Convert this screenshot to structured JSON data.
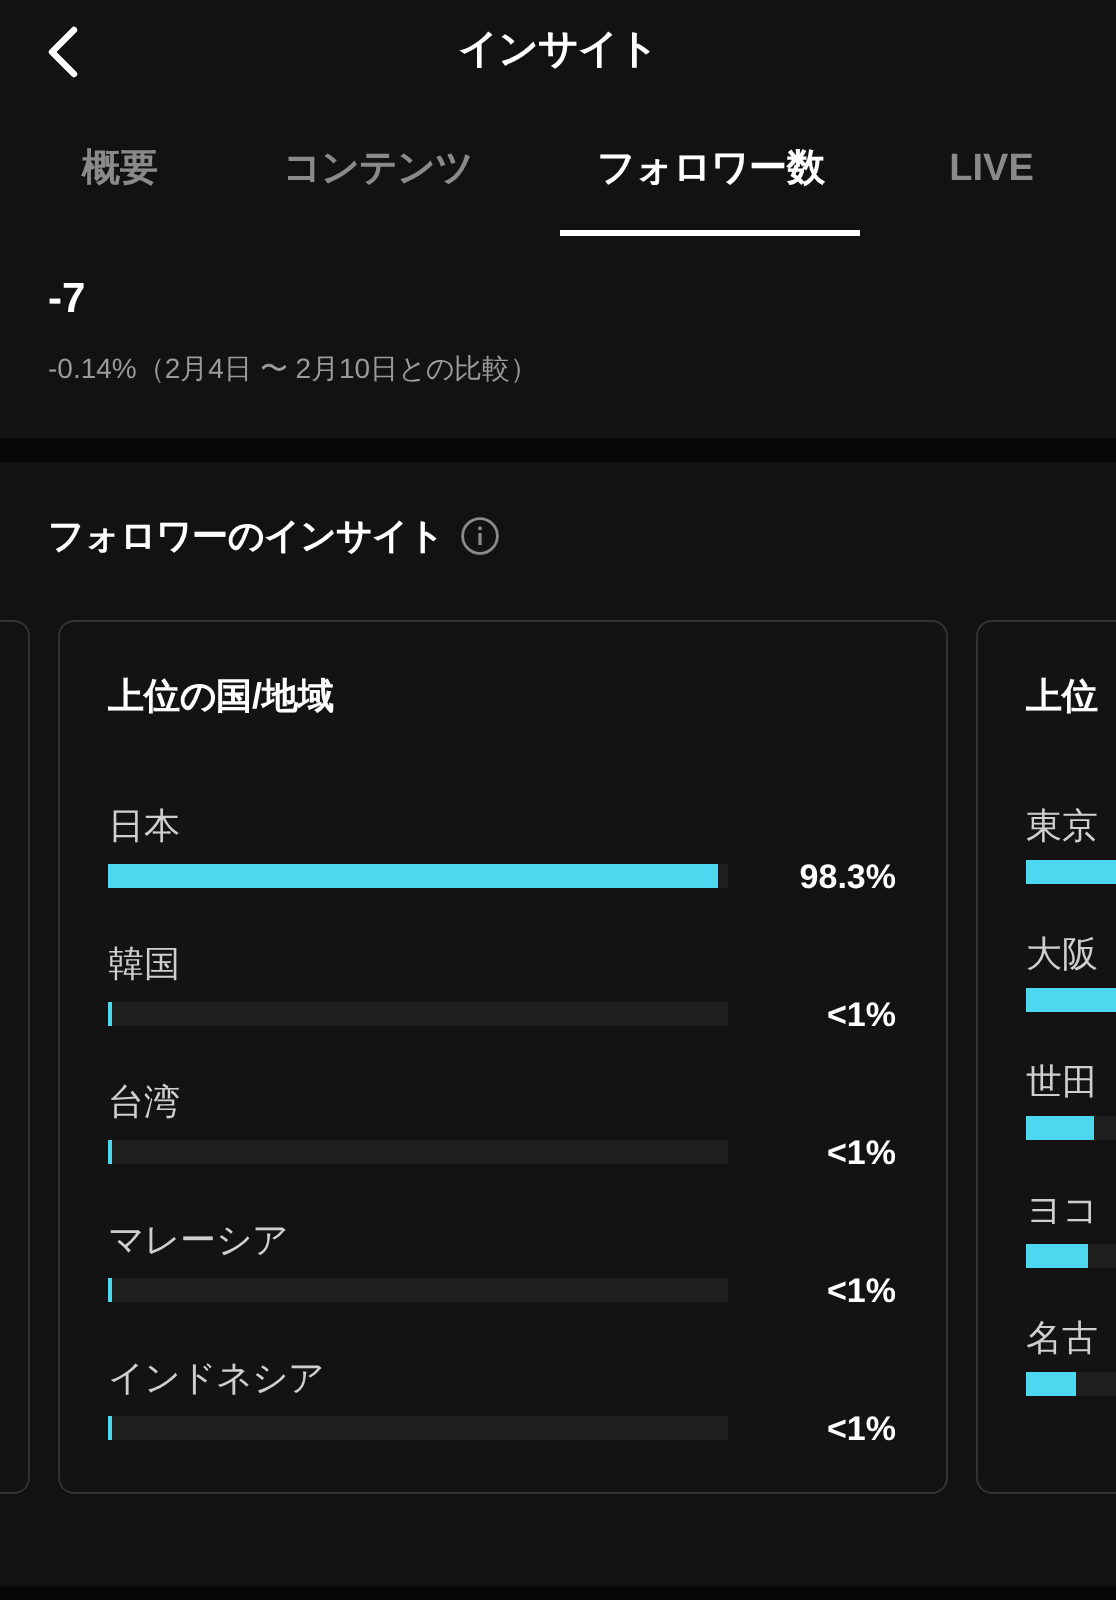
{
  "header": {
    "title": "インサイト"
  },
  "tabs": [
    {
      "label": "概要",
      "selected": false
    },
    {
      "label": "コンテンツ",
      "selected": false
    },
    {
      "label": "フォロワー数",
      "selected": true
    },
    {
      "label": "LIVE",
      "selected": false
    }
  ],
  "summary": {
    "value": "-7",
    "comparison": "-0.14%（2月4日 〜 2月10日との比較）"
  },
  "section": {
    "title": "フォロワーのインサイト"
  },
  "cards": [
    {
      "title": "上位の国/地域",
      "rows": [
        {
          "label": "日本",
          "level": 0.983,
          "reading": "98.3%"
        },
        {
          "label": "韓国",
          "level": 0.007,
          "reading": "<1%"
        },
        {
          "label": "台湾",
          "level": 0.005,
          "reading": "<1%"
        },
        {
          "label": "マレーシア",
          "level": 0.005,
          "reading": "<1%"
        },
        {
          "label": "インドネシア",
          "level": 0.005,
          "reading": "<1%"
        }
      ]
    },
    {
      "title": "上位",
      "rows": [
        {
          "label": "東京",
          "level": 0.4
        },
        {
          "label": "大阪",
          "level": 0.3
        },
        {
          "label": "世田",
          "level": 0.11
        },
        {
          "label": "ヨコ",
          "level": 0.1
        },
        {
          "label": "名古",
          "level": 0.08
        }
      ]
    }
  ]
}
